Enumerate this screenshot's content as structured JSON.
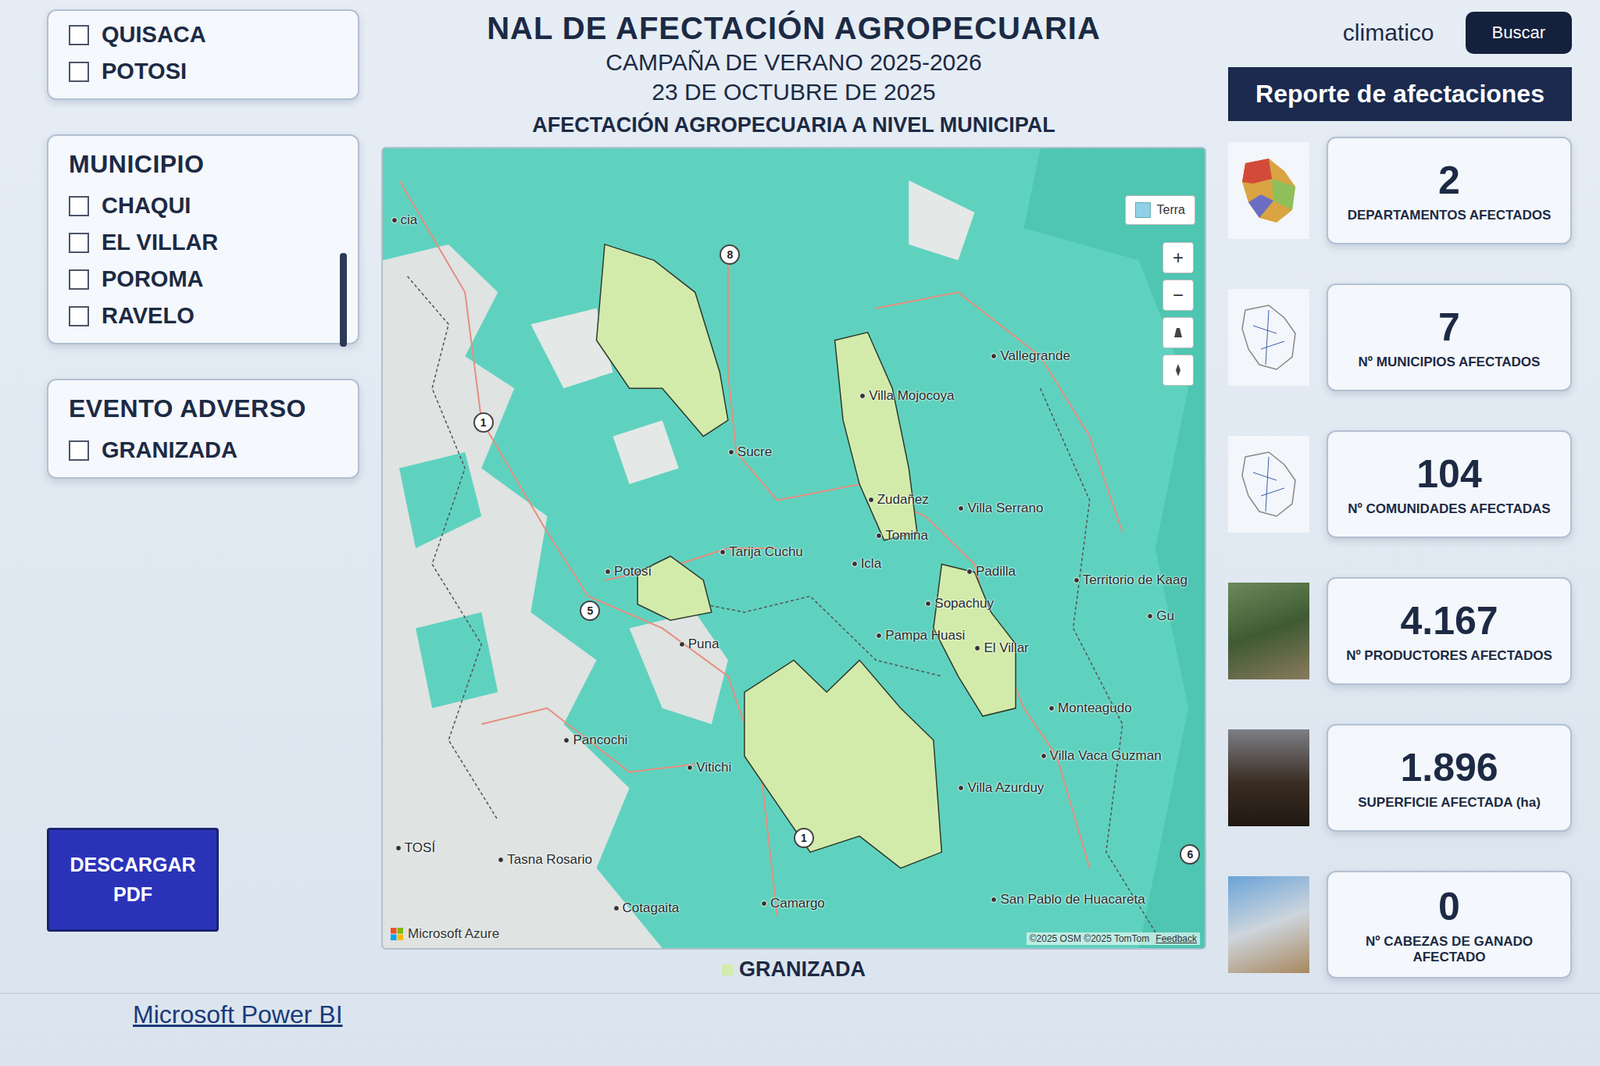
{
  "top_bar": {
    "app_title": "climatico",
    "search_button": "Buscar"
  },
  "report_banner": "Reporte de afectaciones",
  "filters": {
    "departamentos": [
      {
        "label": "QUISACA",
        "checked": false
      },
      {
        "label": "POTOSI",
        "checked": false
      }
    ],
    "municipio": {
      "title": "MUNICIPIO",
      "items": [
        {
          "label": "CHAQUI",
          "checked": false
        },
        {
          "label": "EL VILLAR",
          "checked": false
        },
        {
          "label": "POROMA",
          "checked": false
        },
        {
          "label": "RAVELO",
          "checked": false
        }
      ]
    },
    "evento": {
      "title": "EVENTO ADVERSO",
      "items": [
        {
          "label": "GRANIZADA",
          "checked": false
        }
      ]
    }
  },
  "download_button": "DESCARGAR PDF",
  "map": {
    "title": "NAL DE AFECTACIÓN AGROPECUARIA",
    "subtitle": "CAMPAÑA DE VERANO 2025-2026",
    "date": "23 DE OCTUBRE DE 2025",
    "heading": "AFECTACIÓN AGROPECUARIA A NIVEL MUNICIPAL",
    "places": [
      "cia",
      "Vallegrande",
      "Villa Mojocoya",
      "Sucre",
      "Zudañez",
      "Villa Serrano",
      "Tomina",
      "Icla",
      "Padilla",
      "Tarija Cuchu",
      "Potosí",
      "Puna",
      "Sopachuy",
      "Pampa Huasi",
      "El Villar",
      "Territorio de Kaag",
      "Gu",
      "Monteagudo",
      "Villa Vaca Guzman",
      "Villa Azurduy",
      "Pancochi",
      "Vitichi",
      "Tasna Rosario",
      "Cotagaita",
      "Camargo",
      "San Pablo de Huacareta",
      "TOSÍ"
    ],
    "road_shields": [
      "8",
      "1",
      "5",
      "1",
      "6"
    ],
    "style_button": "Terra",
    "zoom_in": "+",
    "zoom_out": "−",
    "brand": "Microsoft Azure",
    "attribution": "©2025 OSM ©2025 TomTom",
    "feedback": "Feedback",
    "legend": {
      "label": "GRANIZADA",
      "color": "#d3ebaa"
    }
  },
  "kpis": [
    {
      "value": "2",
      "label": "DEPARTAMENTOS AFECTADOS"
    },
    {
      "value": "7",
      "label": "Nº MUNICIPIOS AFECTADOS"
    },
    {
      "value": "104",
      "label": "Nº COMUNIDADES AFECTADAS"
    },
    {
      "value": "4.167",
      "label": "Nº PRODUCTORES AFECTADOS"
    },
    {
      "value": "1.896",
      "label": "SUPERFICIE AFECTADA (ha)"
    },
    {
      "value": "0",
      "label": "Nº CABEZAS DE GANADO AFECTADO"
    }
  ],
  "footer_link": "Microsoft Power BI"
}
